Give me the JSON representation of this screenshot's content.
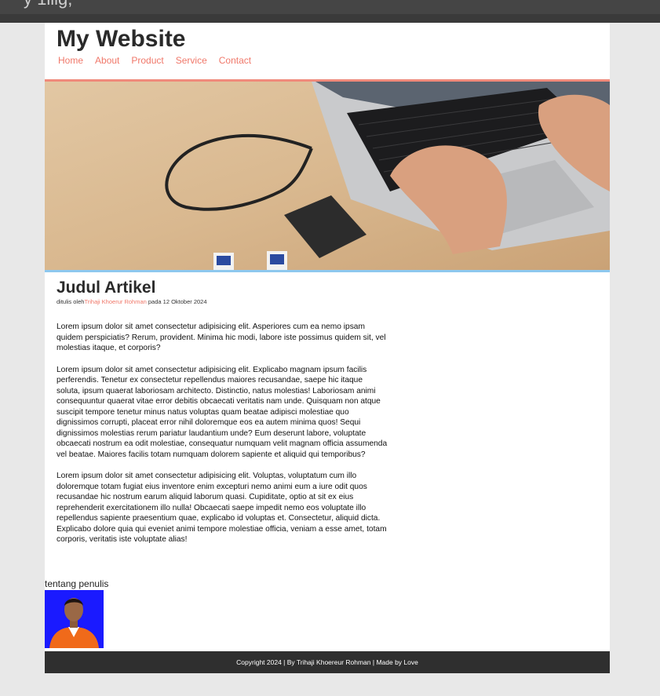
{
  "header": {
    "site_title": "My Website",
    "nav": [
      "Home",
      "About",
      "Product",
      "Service",
      "Contact"
    ]
  },
  "article": {
    "title": "Judul Artikel",
    "byline_prefix": "ditulis oleh",
    "author": "Trihaji Khoerur Rohman",
    "byline_suffix": " pada 12 Oktober 2024",
    "paragraphs": [
      "Lorem ipsum dolor sit amet consectetur adipisicing elit. Asperiores cum ea nemo ipsam quidem perspiciatis? Rerum, provident. Minima hic modi, labore iste possimus quidem sit, vel molestias itaque, et corporis?",
      "Lorem ipsum dolor sit amet consectetur adipisicing elit. Explicabo magnam ipsum facilis perferendis. Tenetur ex consectetur repellendus maiores recusandae, saepe hic itaque soluta, ipsum quaerat laboriosam architecto. Distinctio, natus molestias! Laboriosam animi consequuntur quaerat vitae error debitis obcaecati veritatis nam unde. Quisquam non atque suscipit tempore tenetur minus natus voluptas quam beatae adipisci molestiae quo dignissimos corrupti, placeat error nihil doloremque eos ea autem minima quos! Sequi dignissimos molestias rerum pariatur laudantium unde? Eum deserunt labore, voluptate obcaecati nostrum ea odit molestiae, consequatur numquam velit magnam officia assumenda vel beatae. Maiores facilis totam numquam dolorem sapiente et aliquid qui temporibus?",
      "Lorem ipsum dolor sit amet consectetur adipisicing elit. Voluptas, voluptatum cum illo doloremque totam fugiat eius inventore enim excepturi nemo animi eum a iure odit quos recusandae hic nostrum earum aliquid laborum quasi. Cupiditate, optio at sit ex eius reprehenderit exercitationem illo nulla! Obcaecati saepe impedit nemo eos voluptate illo repellendus sapiente praesentium quae, explicabo id voluptas et. Consectetur, aliquid dicta. Explicabo dolore quia qui eveniet animi tempore molestiae officia, veniam a esse amet, totam corporis, veritatis iste voluptate alias!"
    ]
  },
  "about": {
    "label": "tentang penulis"
  },
  "footer": {
    "text": "Copyright 2024 | By Trihaji Khoereur Rohman | Made by Love"
  },
  "colors": {
    "accent": "#f0786a",
    "hero_border": "#8ec8ee",
    "footer_bg": "#2f2f2f",
    "avatar_bg": "#1a1aff"
  }
}
